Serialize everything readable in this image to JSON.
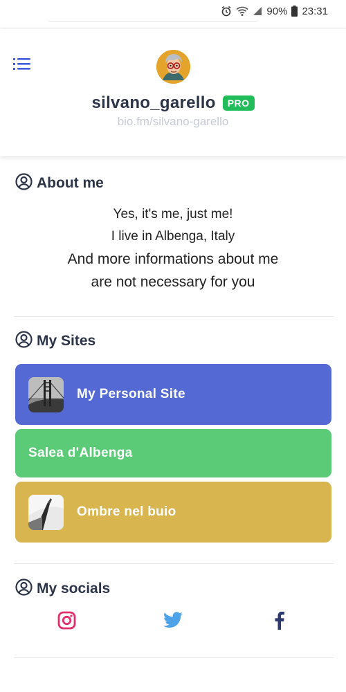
{
  "status_bar": {
    "battery": "90%",
    "time": "23:31"
  },
  "header": {
    "username": "silvano_garello",
    "badge": "PRO",
    "url": "bio.fm/silvano-garello"
  },
  "about": {
    "heading": "About me",
    "lines": [
      "Yes, it's me, just me!",
      "I live in Albenga, Italy",
      "And more informations about me",
      "are not necessary for you"
    ]
  },
  "sites": {
    "heading": "My Sites",
    "items": [
      {
        "label": "My Personal Site",
        "color": "#5469d4"
      },
      {
        "label": "Salea d'Albenga",
        "color": "#5bcb78"
      },
      {
        "label": "Ombre nel buio",
        "color": "#d9b550"
      }
    ]
  },
  "socials": {
    "heading": "My socials",
    "icons": [
      "instagram-icon",
      "twitter-icon",
      "facebook-icon"
    ],
    "colors": {
      "instagram": "#e1306c",
      "twitter": "#4ea3e8",
      "facebook": "#2c3a6e"
    }
  }
}
